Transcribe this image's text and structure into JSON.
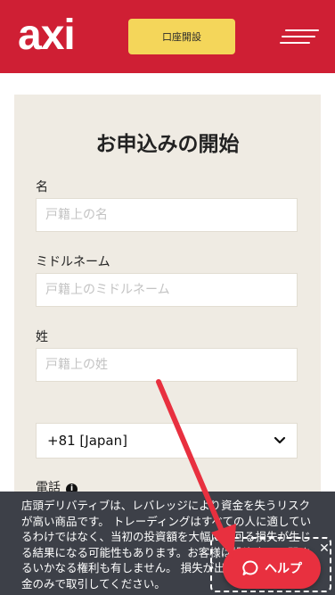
{
  "header": {
    "logo": "axi",
    "cta_label": "口座開設",
    "menu_icon": "hamburger-icon",
    "background": "#cf1f34",
    "cta_color": "#f4d65a"
  },
  "form": {
    "title": "お申込みの開始",
    "first_name": {
      "label": "名",
      "placeholder": "戸籍上の名",
      "value": ""
    },
    "middle_name": {
      "label": "ミドルネーム",
      "placeholder": "戸籍上のミドルネーム",
      "value": ""
    },
    "last_name": {
      "label": "姓",
      "placeholder": "戸籍上の姓",
      "value": ""
    },
    "country_code": {
      "selected": "+81 [Japan]",
      "icon": "chevron-down-icon"
    },
    "phone": {
      "label": "電話",
      "info_icon": "info-icon"
    }
  },
  "risk_banner": {
    "text": "店頭デリバティブは、レバレッジにより資金を失うリスクが高い商品です。 トレーディングはすべての人に適しているわけではなく、当初の投資額を大幅に上回る損失が生じる結果になる可能性もあります。お客様は投資商品に関するいかなる権利も有しません。 損失が出ても問題のない資金のみで取引してください。",
    "close_icon": "close-icon"
  },
  "help": {
    "label": "ヘルプ",
    "icon": "chat-bubble-icon",
    "color": "#e8303f"
  },
  "annotation": {
    "arrow_color": "#e8303f"
  }
}
